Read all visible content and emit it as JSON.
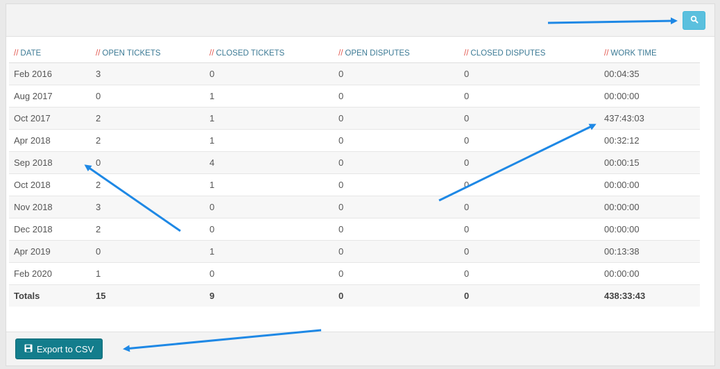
{
  "toolbar": {
    "search_icon": "search-icon"
  },
  "table": {
    "headers": [
      "DATE",
      "OPEN TICKETS",
      "CLOSED TICKETS",
      "OPEN DISPUTES",
      "CLOSED DISPUTES",
      "WORK TIME"
    ],
    "header_prefix": "//",
    "rows": [
      [
        "Feb 2016",
        "3",
        "0",
        "0",
        "0",
        "00:04:35"
      ],
      [
        "Aug 2017",
        "0",
        "1",
        "0",
        "0",
        "00:00:00"
      ],
      [
        "Oct 2017",
        "2",
        "1",
        "0",
        "0",
        "437:43:03"
      ],
      [
        "Apr 2018",
        "2",
        "1",
        "0",
        "0",
        "00:32:12"
      ],
      [
        "Sep 2018",
        "0",
        "4",
        "0",
        "0",
        "00:00:15"
      ],
      [
        "Oct 2018",
        "2",
        "1",
        "0",
        "0",
        "00:00:00"
      ],
      [
        "Nov 2018",
        "3",
        "0",
        "0",
        "0",
        "00:00:00"
      ],
      [
        "Dec 2018",
        "2",
        "0",
        "0",
        "0",
        "00:00:00"
      ],
      [
        "Apr 2019",
        "0",
        "1",
        "0",
        "0",
        "00:13:38"
      ],
      [
        "Feb 2020",
        "1",
        "0",
        "0",
        "0",
        "00:00:00"
      ]
    ],
    "totals": [
      "Totals",
      "15",
      "9",
      "0",
      "0",
      "438:33:43"
    ]
  },
  "footer": {
    "export_label": "Export to CSV",
    "export_icon": "save-icon"
  },
  "colors": {
    "accent": "#137d8c",
    "search": "#5bc0de",
    "header_text": "#3c7a95",
    "header_slash": "#e2534b",
    "annotation_arrow": "#1e88e5"
  }
}
